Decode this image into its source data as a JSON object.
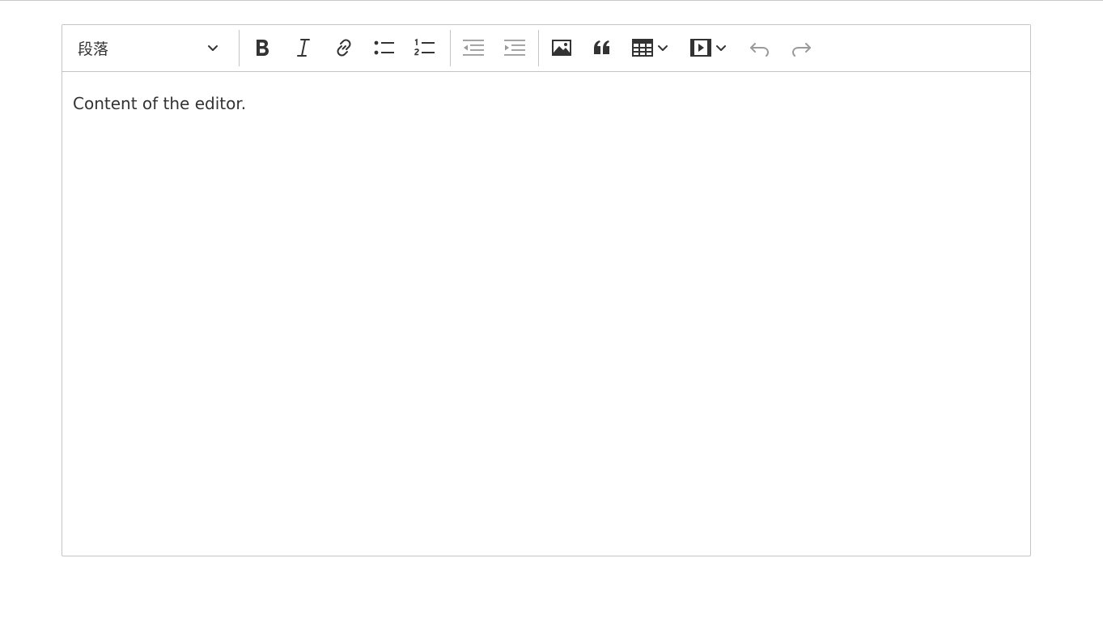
{
  "toolbar": {
    "heading_select": {
      "value": "段落",
      "icon": "chevron-down-icon"
    },
    "groups": [
      [
        "bold-icon",
        "italic-icon",
        "link-icon",
        "bulleted-list-icon",
        "numbered-list-icon"
      ],
      [
        "outdent-icon",
        "indent-icon"
      ],
      [
        "image-icon",
        "blockquote-icon",
        "table-icon",
        "media-icon",
        "undo-icon",
        "redo-icon"
      ]
    ]
  },
  "editor": {
    "content": "Content of the editor."
  },
  "colors": {
    "border": "#c4c4c4",
    "icon_active": "#333333",
    "icon_disabled": "#9a9a9a",
    "text": "#333333"
  }
}
